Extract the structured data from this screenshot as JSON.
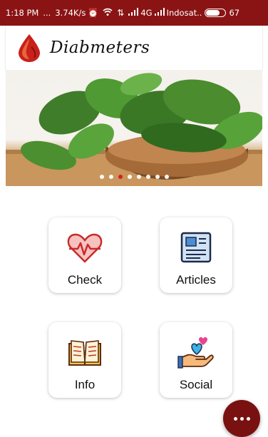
{
  "status_bar": {
    "time": "1:18 PM",
    "ellipsis": "...",
    "speed": "3.74K/s",
    "network": "4G",
    "carrier": "Indosat..",
    "battery": "67"
  },
  "app": {
    "title": "Diabmeters"
  },
  "banner": {
    "slide_count": 8,
    "active_index": 2
  },
  "tiles": [
    {
      "label": "Check",
      "icon": "heart-pulse-icon"
    },
    {
      "label": "Articles",
      "icon": "newspaper-icon"
    },
    {
      "label": "Info",
      "icon": "open-book-icon"
    },
    {
      "label": "Social",
      "icon": "hand-heart-icon"
    }
  ],
  "fab": {
    "icon": "more-dots-icon"
  },
  "colors": {
    "primary": "#8a1414",
    "accent": "#d31b1b",
    "fab": "#7a1111"
  }
}
